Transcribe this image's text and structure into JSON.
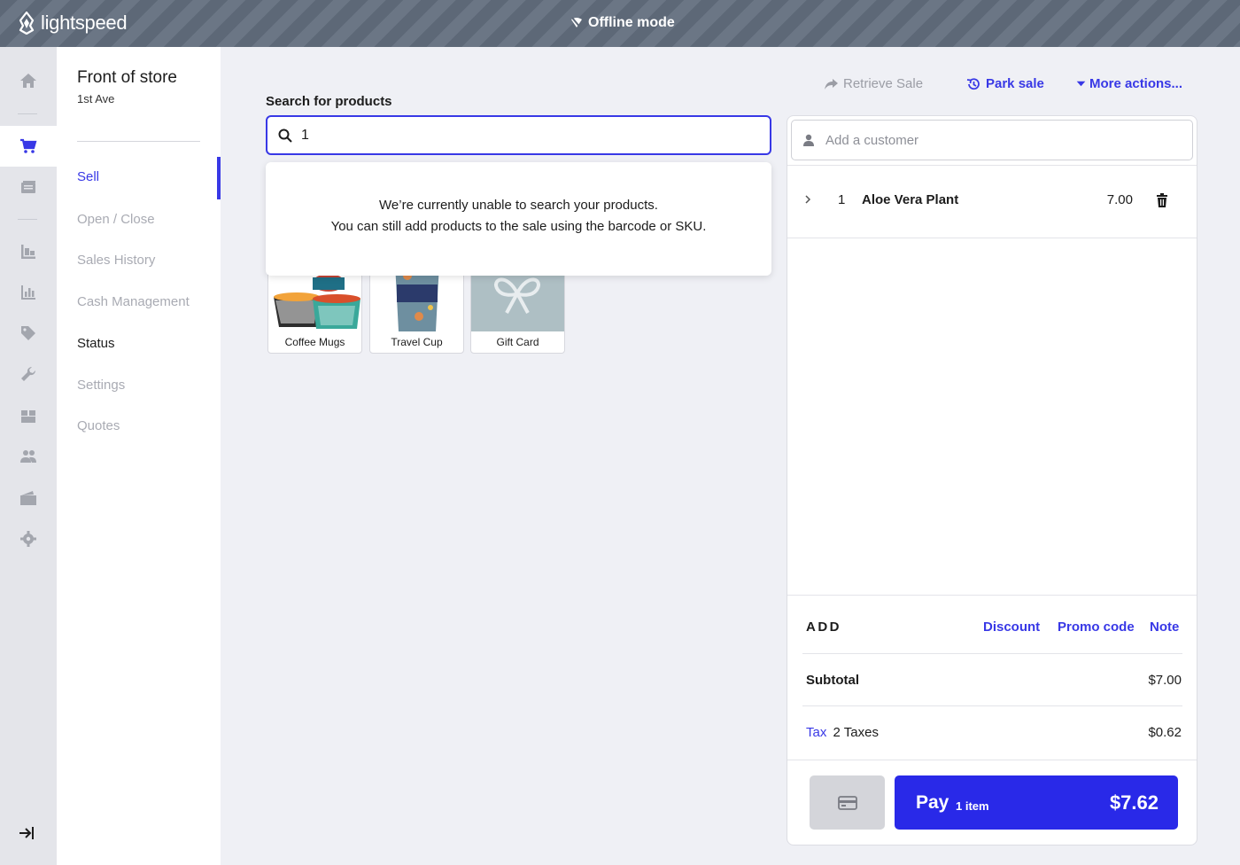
{
  "app": {
    "logo_text": "lightspeed",
    "offline_label": "Offline mode"
  },
  "rail": {
    "items": [
      {
        "name": "home-icon",
        "active": false
      },
      {
        "name": "cart-icon",
        "active": true
      },
      {
        "name": "register-icon",
        "active": false
      },
      {
        "name": "inventory-icon",
        "active": false
      },
      {
        "name": "reports-icon",
        "active": false
      },
      {
        "name": "tag-icon",
        "active": false
      },
      {
        "name": "wrench-icon",
        "active": false
      },
      {
        "name": "boxes-icon",
        "active": false
      },
      {
        "name": "customers-icon",
        "active": false
      },
      {
        "name": "wallet-icon",
        "active": false
      },
      {
        "name": "gear-icon",
        "active": false
      }
    ],
    "collapse_icon": "collapse-arrow-icon"
  },
  "store": {
    "title": "Front of store",
    "subtitle": "1st Ave"
  },
  "menu": {
    "items": [
      {
        "label": "Sell"
      },
      {
        "label": "Open / Close"
      },
      {
        "label": "Sales History"
      },
      {
        "label": "Cash Management"
      },
      {
        "label": "Status"
      },
      {
        "label": "Settings"
      },
      {
        "label": "Quotes"
      }
    ]
  },
  "search": {
    "label": "Search for products",
    "value": "1",
    "message_line1": "We’re currently unable to search your products.",
    "message_line2": "You can still add products to the sale using the barcode or SKU."
  },
  "tiles": [
    {
      "label": "Coffee Mugs"
    },
    {
      "label": "Travel Cup"
    },
    {
      "label": "Gift Card"
    }
  ],
  "actions": {
    "retrieve": "Retrieve Sale",
    "park": "Park sale",
    "more": "More actions..."
  },
  "cart": {
    "customer_placeholder": "Add a customer",
    "line_items": [
      {
        "qty": "1",
        "name": "Aloe Vera Plant",
        "price": "7.00"
      }
    ],
    "add_label": "ADD",
    "add_links": {
      "discount": "Discount",
      "promo": "Promo code",
      "note": "Note"
    },
    "subtotal_label": "Subtotal",
    "subtotal_value": "$7.00",
    "tax_label": "Tax",
    "tax_detail": "2 Taxes",
    "tax_value": "$0.62",
    "pay_label": "Pay",
    "pay_count": "1 item",
    "pay_total": "$7.62"
  },
  "colors": {
    "accent": "#3838e6",
    "pay": "#2929e8",
    "topbar": "#5d6877"
  }
}
